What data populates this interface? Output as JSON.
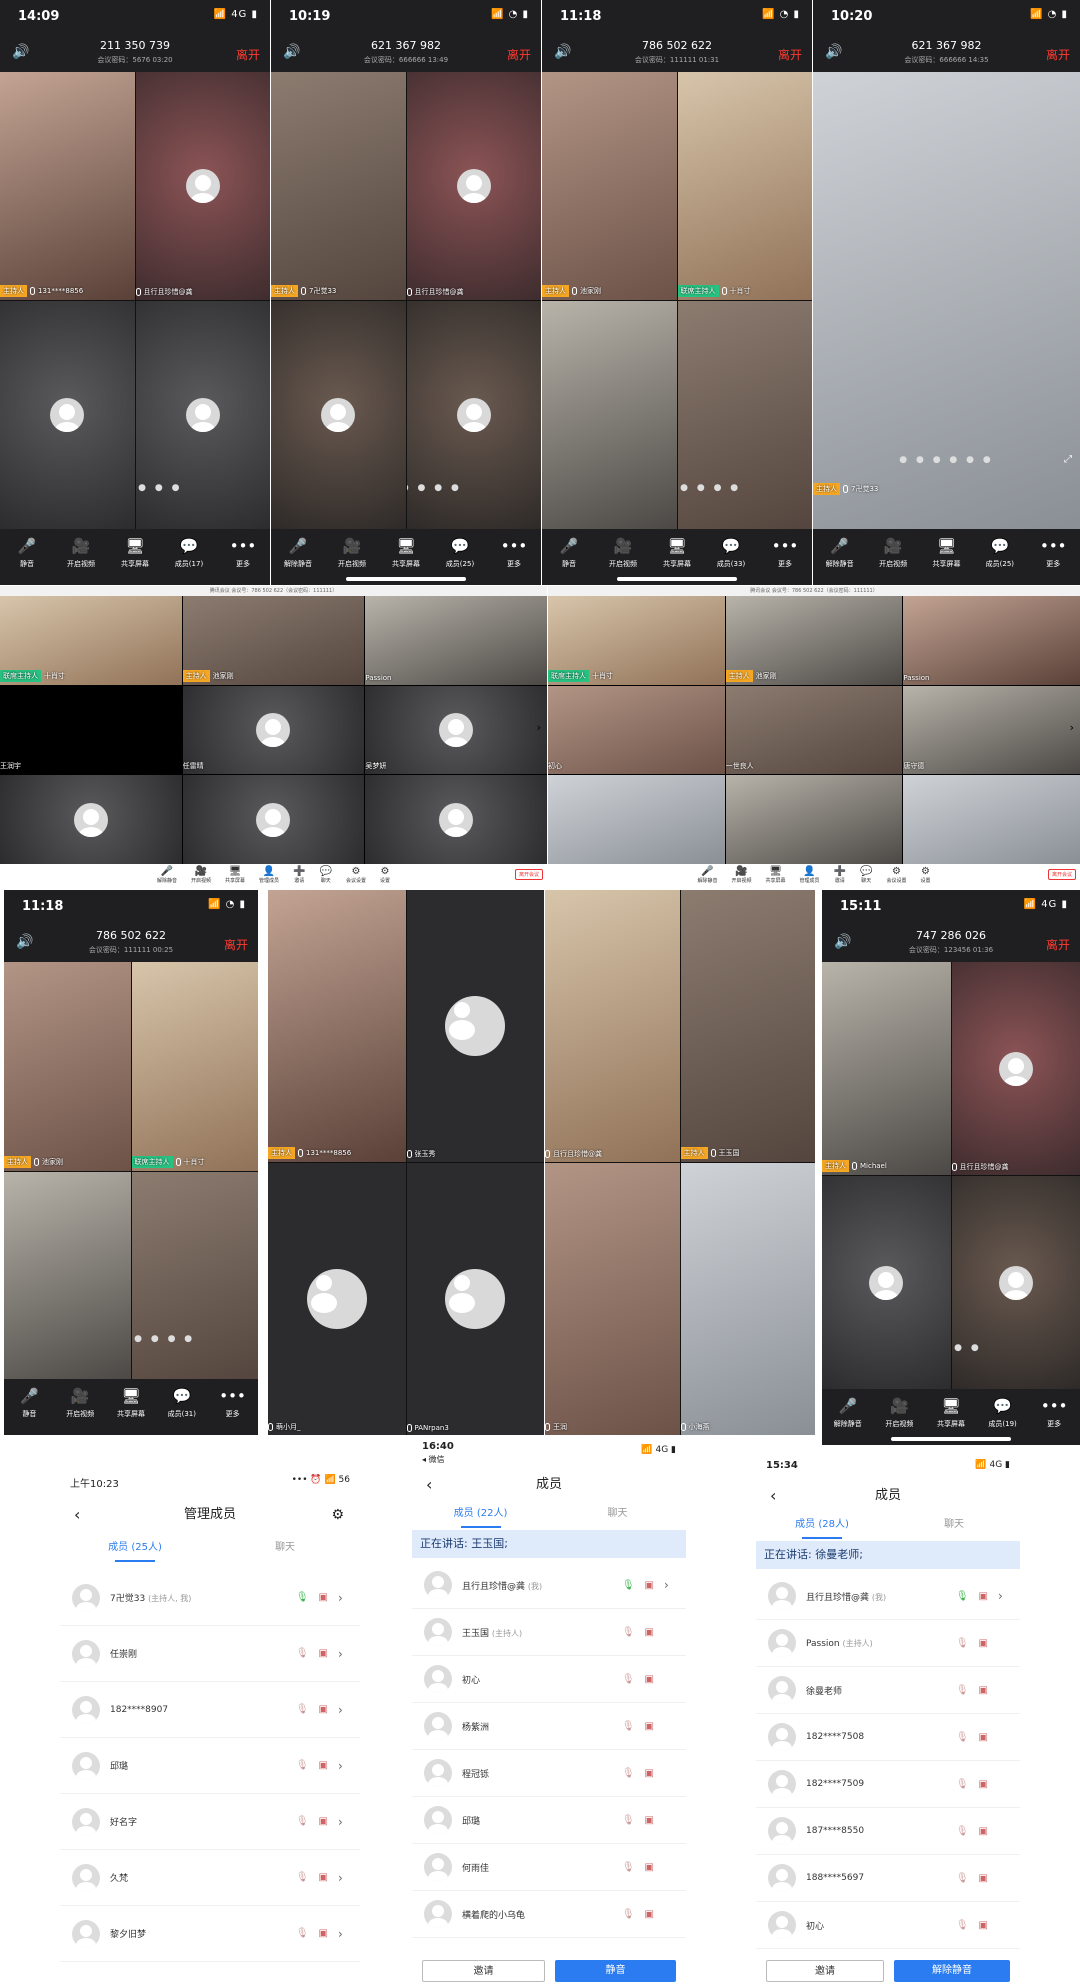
{
  "p1": {
    "time": "14:09",
    "net": "4G",
    "mid": "211 350 739",
    "pwd": "会议密码：5676",
    "dur": "03:20",
    "leave": "离开",
    "host": "主持人",
    "n1": "131****8856",
    "n2": "且行且珍惜@龚",
    "dots": "● ● ● ● ● ●"
  },
  "p2": {
    "time": "10:19",
    "mid": "621 367 982",
    "pwd": "会议密码：666666",
    "dur": "13:49",
    "leave": "离开",
    "host": "主持人",
    "n1": "7卍觉33",
    "n2": "且行且珍惜@龚",
    "dots": "● ● ● ● ● ● ●"
  },
  "p3": {
    "time": "11:18",
    "mid": "786 502 622",
    "pwd": "会议密码：111111",
    "dur": "01:31",
    "leave": "离开",
    "host": "主持人",
    "n1": "池家刚",
    "cohost": "联席主持人",
    "n2": "十肖寸",
    "dots": "● ● ● ● ● ● ● ●"
  },
  "p4": {
    "time": "10:20",
    "mid": "621 367 982",
    "pwd": "会议密码：666666",
    "dur": "14:35",
    "leave": "离开",
    "host": "主持人",
    "n1": "7卍觉33",
    "dots": "● ● ● ● ● ●"
  },
  "tb1": [
    {
      "icon": "🎤",
      "label": "静音"
    },
    {
      "icon": "🎥",
      "label": "开启视频"
    },
    {
      "icon": "🖥",
      "label": "共享屏幕"
    },
    {
      "icon": "💬",
      "label": "成员(17)"
    },
    {
      "icon": "•••",
      "label": "更多"
    }
  ],
  "tb2": [
    {
      "icon": "🎤",
      "label": "解除静音"
    },
    {
      "icon": "🎥",
      "label": "开启视频"
    },
    {
      "icon": "🖥",
      "label": "共享屏幕"
    },
    {
      "icon": "💬",
      "label": "成员(25)"
    },
    {
      "icon": "•••",
      "label": "更多"
    }
  ],
  "tb3": [
    {
      "icon": "🎤",
      "label": "静音"
    },
    {
      "icon": "🎥",
      "label": "开启视频"
    },
    {
      "icon": "🖥",
      "label": "共享屏幕"
    },
    {
      "icon": "💬",
      "label": "成员(33)"
    },
    {
      "icon": "•••",
      "label": "更多"
    }
  ],
  "tb4": [
    {
      "icon": "🎤",
      "label": "解除静音"
    },
    {
      "icon": "🎥",
      "label": "开启视频"
    },
    {
      "icon": "🖥",
      "label": "共享屏幕"
    },
    {
      "icon": "💬",
      "label": "成员(25)"
    },
    {
      "icon": "•••",
      "label": "更多"
    }
  ],
  "pc": {
    "title": "腾讯会议 会议号：786 502 622（会议密码：111111）",
    "cohost": "联席主持人",
    "host": "主持人",
    "a1": "十肖寸",
    "a2": "池家刚",
    "a3": "Passion",
    "a4": "王润宇",
    "a5": "任雷晴",
    "a6": "吴梦妍",
    "b4": "初心",
    "b5": "一世良人",
    "b6": "唐守德",
    "leave": "离开会议",
    "bar": [
      "解除静音",
      "开启视频",
      "共享屏幕",
      "管理成员",
      "邀请",
      "聊天",
      "会议设置",
      "设置"
    ]
  },
  "r2a": {
    "time": "11:18",
    "mid": "786 502 622",
    "pwd": "会议密码：111111",
    "dur": "00:25",
    "leave": "离开",
    "host": "主持人",
    "n1": "池家刚",
    "cohost": "联席主持人",
    "n2": "十肖寸",
    "dots": "● ● ● ● ● ● ● ●"
  },
  "tb5": [
    {
      "icon": "🎤",
      "label": "静音"
    },
    {
      "icon": "🎥",
      "label": "开启视频"
    },
    {
      "icon": "🖥",
      "label": "共享屏幕"
    },
    {
      "icon": "💬",
      "label": "成员(31)"
    },
    {
      "icon": "•••",
      "label": "更多"
    }
  ],
  "r2b": {
    "host": "主持人",
    "n1": "131****8856",
    "n2": "张玉秀",
    "n3": "萌小月_",
    "n4": "PANrpan3"
  },
  "r2c": {
    "n1": "且行且珍惜@龚",
    "host": "主持人",
    "n2": "王玉国",
    "n3": "王润",
    "n4": "小海燕"
  },
  "r2d": {
    "time": "15:11",
    "net": "4G",
    "mid": "747 286 026",
    "pwd": "会议密码：123456",
    "dur": "01:36",
    "leave": "离开",
    "host": "主持人",
    "n1": "Michael",
    "n2": "且行且珍惜@龚",
    "dots": "● ● ● ●"
  },
  "tb6": [
    {
      "icon": "🎤",
      "label": "解除静音"
    },
    {
      "icon": "🎥",
      "label": "开启视频"
    },
    {
      "icon": "🖥",
      "label": "共享屏幕"
    },
    {
      "icon": "💬",
      "label": "成员(19)"
    },
    {
      "icon": "•••",
      "label": "更多"
    }
  ],
  "m1": {
    "time": "上午10:23",
    "status": "••• ⏰ 📶 56",
    "title": "管理成员",
    "tab1": "成员 (25人)",
    "tab2": "聊天",
    "rows": [
      {
        "name": "7卍觉33",
        "note": "(主持人, 我)"
      },
      {
        "name": "任崇刚",
        "note": ""
      },
      {
        "name": "182****8907",
        "note": ""
      },
      {
        "name": "邱璐",
        "note": ""
      },
      {
        "name": "好名字",
        "note": ""
      },
      {
        "name": "久梵",
        "note": ""
      },
      {
        "name": "黎夕旧梦",
        "note": ""
      }
    ]
  },
  "m2": {
    "time": "16:40",
    "back": "◂ 微信",
    "net": "4G",
    "title": "成员",
    "tab1": "成员 (22人)",
    "tab2": "聊天",
    "speaking": "正在讲话: 王玉国;",
    "rows": [
      {
        "name": "且行且珍惜@龚",
        "note": "(我)"
      },
      {
        "name": "王玉国",
        "note": "(主持人)"
      },
      {
        "name": "初心",
        "note": ""
      },
      {
        "name": "杨紫洲",
        "note": ""
      },
      {
        "name": "程冠铄",
        "note": ""
      },
      {
        "name": "邱璐",
        "note": ""
      },
      {
        "name": "何雨佳",
        "note": ""
      },
      {
        "name": "横着爬的小乌龟",
        "note": ""
      }
    ],
    "invite": "邀请",
    "mute": "静音"
  },
  "m3": {
    "time": "15:34",
    "net": "4G",
    "title": "成员",
    "tab1": "成员 (28人)",
    "tab2": "聊天",
    "speaking": "正在讲话: 徐曼老师;",
    "rows": [
      {
        "name": "且行且珍惜@龚",
        "note": "(我)"
      },
      {
        "name": "Passion",
        "note": "(主持人)"
      },
      {
        "name": "徐曼老师",
        "note": ""
      },
      {
        "name": "182****7508",
        "note": ""
      },
      {
        "name": "182****7509",
        "note": ""
      },
      {
        "name": "187****8550",
        "note": ""
      },
      {
        "name": "188****5697",
        "note": ""
      },
      {
        "name": "初心",
        "note": ""
      }
    ],
    "invite": "邀请",
    "unmute": "解除静音"
  },
  "colors": {
    "host": "#f5a623",
    "cohost": "#27c281",
    "accent": "#2a7cf0",
    "leave": "#ff3b30"
  }
}
